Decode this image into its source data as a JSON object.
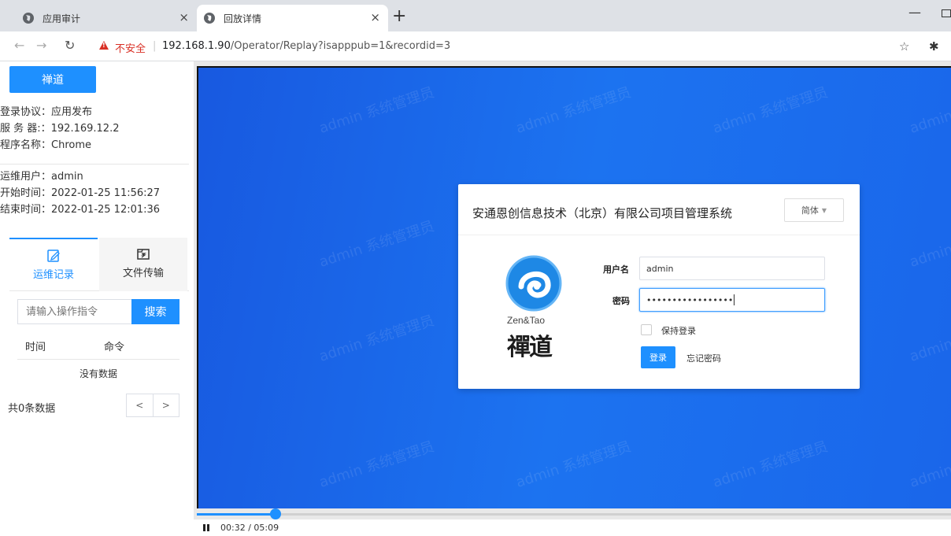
{
  "browser": {
    "tabs": [
      {
        "title": "应用审计",
        "icon": "globe-icon"
      },
      {
        "title": "回放详情",
        "icon": "globe-icon",
        "active": true
      }
    ],
    "new_tab": "+",
    "close": "×",
    "security_label": "不安全",
    "url_host": "192.168.1.90",
    "url_path": "/Operator/Replay?isapppub=1&recordid=3",
    "separator": "|"
  },
  "sidebar": {
    "brand": "禅道",
    "protocol": "登录协议：应用发布",
    "server": "服 务 器:：192.169.12.2",
    "program": "程序名称：Chrome",
    "user": "运维用户：admin",
    "start": "开始时间：2022-01-25 11:56:27",
    "end": "结束时间：2022-01-25 12:01:36",
    "tabs": {
      "ops": "运维记录",
      "file": "文件传输"
    },
    "search": {
      "placeholder": "请输入操作指令",
      "button": "搜索"
    },
    "table": {
      "col_time": "时间",
      "col_cmd": "命令",
      "empty": "没有数据"
    },
    "total": "共0条数据",
    "pager": {
      "prev": "<",
      "next": ">"
    }
  },
  "replay": {
    "watermark": "admin 系统管理员",
    "login": {
      "title": "安通恩创信息技术（北京）有限公司项目管理系统",
      "lang": "简体",
      "logo_en": "Zen&Tao",
      "logo_cn": "禪道",
      "user_label": "用户名",
      "user_value": "admin",
      "pwd_label": "密码",
      "pwd_value": "•••••••••••••••••",
      "remember": "保持登录",
      "login_button": "登录",
      "forgot": "忘记密码"
    },
    "progress": 0.104,
    "time": "00:32 / 05:09",
    "accent": "#1e90ff"
  }
}
